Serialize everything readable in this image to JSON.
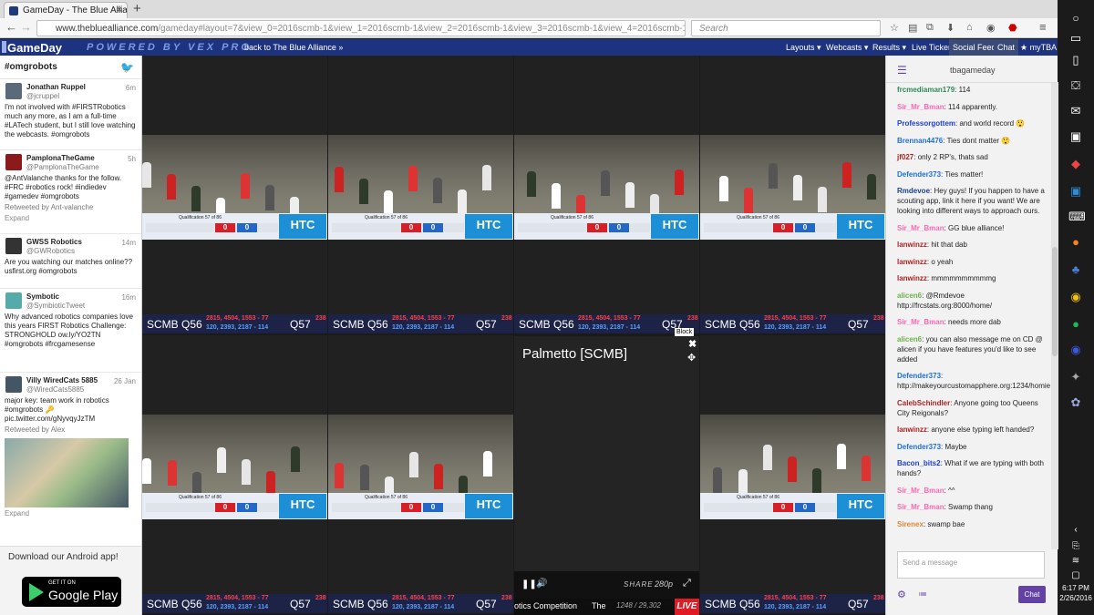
{
  "browser": {
    "tab_title": "GameDay - The Blue Allia...",
    "url_domain": "www.thebluealliance.com",
    "url_path": "/gameday#layout=7&view_0=2016scmb-1&view_1=2016scmb-1&view_2=2016scmb-1&view_3=2016scmb-1&view_4=2016scmb-1&view_5=...",
    "search_placeholder": "Search"
  },
  "taskbar": {
    "time": "6:17 PM",
    "date": "2/26/2016"
  },
  "gameday": {
    "logo": "GameDay",
    "powered_by": "POWERED BY VEX PRO",
    "back_link": "back to The Blue Alliance »",
    "menu": [
      "Layouts ▾",
      "Webcasts ▾",
      "Results ▾",
      "Live Ticker",
      "Social Feed",
      "Chat",
      "★ myTBA"
    ]
  },
  "twitter": {
    "hashtag": "#omgrobots",
    "tweets": [
      {
        "name": "Jonathan Ruppel",
        "handle": "@jcruppel",
        "time": "6m",
        "text": "I'm not involved with #FIRSTRobotics much any more, as I am a full-time #LATech student, but I still love watching the webcasts. #omgrobots",
        "extra": ""
      },
      {
        "name": "PamplonaTheGame",
        "handle": "@PamplonaTheGame",
        "time": "5h",
        "text": "@AntValanche thanks for the follow. #FRC #robotics rock! #indiedev #gamedev #omgrobots",
        "retweet": "Retweeted by Ant-valanche",
        "extra": "Expand"
      },
      {
        "name": "GWSS Robotics",
        "handle": "@GWRobotics",
        "time": "14m",
        "text": "Are you watching our matches online?? usfirst.org #omgrobots",
        "extra": ""
      },
      {
        "name": "Symbotic",
        "handle": "@SymbioticTweet",
        "time": "16m",
        "text": "Why advanced robotics companies love this years FIRST Robotics Challenge: STRONGHOLD ow.ly/YO2TN #omgrobots #frcgamesense",
        "extra": ""
      },
      {
        "name": "Villy WiredCats 5885",
        "handle": "@WiredCats5885",
        "time": "26 Jan",
        "text": "major key: team work in robotics #omgrobots 🔑 pic.twitter.com/gNyvqyJzTM",
        "retweet": "Retweeted by Alex",
        "extra": "Expand"
      }
    ],
    "android_text": "Download our Android app!",
    "gplay_small": "GET IT ON",
    "gplay_big": "Google Play"
  },
  "video": {
    "ticker_match": "SCMB Q56",
    "ticker_red": "2815, 4504, 1553 - 77",
    "ticker_blue": "120, 2393, 2187 - 114",
    "ticker_next": "Q57",
    "ticker_next_red": "238",
    "ticker_next_blue": "407",
    "overlay_qual": "Qualification 57 of 86",
    "overlay_event": "Palmetto Region",
    "red_score": "0",
    "blue_score": "0",
    "sponsor": "HTC"
  },
  "popup": {
    "block_label": "Block",
    "title": "Palmetto [SCMB]",
    "share": "SHARE",
    "quality": "280p",
    "bottom_text": "otics Competition",
    "bottom_text2": "The",
    "viewers": "1248 / 29,302",
    "live": "LIVE"
  },
  "chat": {
    "channel": "tbagameday",
    "messages": [
      {
        "user": "frcmediaman179",
        "color": "#2e8b57",
        "text": "114"
      },
      {
        "user": "Sir_Mr_Bman",
        "color": "#ff69b4",
        "text": "114 apparently."
      },
      {
        "user": "Professorgottem",
        "color": "#1e3fd8",
        "text": "and world record 😲"
      },
      {
        "user": "Brennan4476",
        "color": "#1e6fd8",
        "text": "Ties dont matter 😲"
      },
      {
        "user": "jf027",
        "color": "#b22222",
        "text": "only 2 RP's, thats sad"
      },
      {
        "user": "Defender373",
        "color": "#1e6fd8",
        "text": "Ties matter!"
      },
      {
        "user": "Rmdevoe",
        "color": "#1e3f8a",
        "text": "Hey guys! If you happen to have a scouting app, link it here if you want! We are looking into different ways to approach ours."
      },
      {
        "user": "Sir_Mr_Bman",
        "color": "#ff69b4",
        "text": "GG blue alliance!"
      },
      {
        "user": "lanwinzz",
        "color": "#b22222",
        "text": "hit that dab"
      },
      {
        "user": "lanwinzz",
        "color": "#b22222",
        "text": "o yeah"
      },
      {
        "user": "lanwinzz",
        "color": "#b22222",
        "text": "mmmmmmmmmmg"
      },
      {
        "user": "alicen6",
        "color": "#6bb34a",
        "text": "@Rmdevoe http://frcstats.org:8000/home/"
      },
      {
        "user": "Sir_Mr_Bman",
        "color": "#ff69b4",
        "text": "needs more dab"
      },
      {
        "user": "alicen6",
        "color": "#6bb34a",
        "text": "you can also message me on CD @ alicen if you have features you'd like to see added"
      },
      {
        "user": "Defender373",
        "color": "#1e6fd8",
        "text": "http://makeyourcustomapphere.org:1234/homie/"
      },
      {
        "user": "CalebSchindler",
        "color": "#b22222",
        "text": "Anyone going too Queens City Reigonals?"
      },
      {
        "user": "lanwinzz",
        "color": "#b22222",
        "text": "anyone else typing left handed?"
      },
      {
        "user": "Defender373",
        "color": "#1e6fd8",
        "text": "Maybe"
      },
      {
        "user": "Bacon_bits2",
        "color": "#1e3fd8",
        "text": "What if we are typing with both hands?"
      },
      {
        "user": "Sir_Mr_Bman",
        "color": "#ff69b4",
        "text": "^^"
      },
      {
        "user": "Sir_Mr_Bman",
        "color": "#ff69b4",
        "text": "Swamp thang"
      },
      {
        "user": "Sirenex",
        "color": "#e0873a",
        "text": "swamp bae"
      }
    ],
    "input_placeholder": "Send a message",
    "button": "Chat"
  }
}
